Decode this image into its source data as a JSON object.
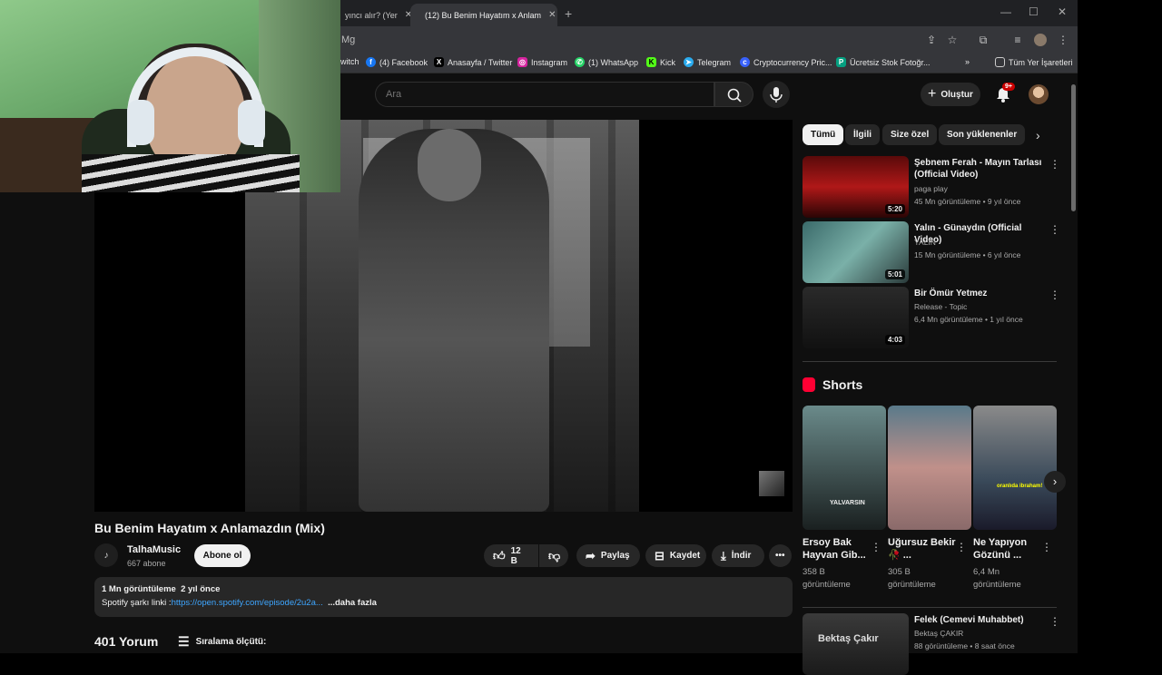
{
  "browser": {
    "tabs": [
      {
        "label": "yıncı alır? (Yer"
      },
      {
        "label": "(12) Bu Benim Hayatım x Anlam"
      }
    ],
    "address": "Mg",
    "bookmarks": [
      {
        "label": "witch",
        "icon": "twitch-icon"
      },
      {
        "label": "(4) Facebook",
        "icon": "facebook-icon",
        "color": "#1877f2"
      },
      {
        "label": "Anasayfa / Twitter",
        "icon": "x-icon",
        "color": "#000000"
      },
      {
        "label": "Instagram",
        "icon": "instagram-icon",
        "color": "#d6249f"
      },
      {
        "label": "(1) WhatsApp",
        "icon": "whatsapp-icon",
        "color": "#25d366"
      },
      {
        "label": "Kick",
        "icon": "kick-icon",
        "color": "#53fc18"
      },
      {
        "label": "Telegram",
        "icon": "telegram-icon",
        "color": "#2aabee"
      },
      {
        "label": "Cryptocurrency Pric...",
        "icon": "coinmarketcap-icon",
        "color": "#3861fb"
      },
      {
        "label": "Ücretsiz Stok Fotoğr...",
        "icon": "pexels-icon",
        "color": "#05a081"
      }
    ],
    "all_bookmarks": "Tüm Yer İşaretleri"
  },
  "youtube": {
    "search_placeholder": "Ara",
    "create_label": "Oluştur",
    "notifications_badge": "9+"
  },
  "video": {
    "title": "Bu Benim Hayatım x Anlamazdın (Mix)",
    "channel": "TalhaMusic",
    "subscribers": "667 abone",
    "subscribe_label": "Abone ol",
    "likes": "12 B",
    "share_label": "Paylaş",
    "save_label": "Kaydet",
    "download_label": "İndir",
    "views": "1 Mn görüntüleme",
    "age": "2 yıl önce",
    "desc_prefix": "Spotify şarkı linki :",
    "desc_link": "https://open.spotify.com/episode/2u2a...",
    "desc_more": "...daha fazla",
    "comments_count": "401 Yorum",
    "sort_label": "Sıralama ölçütü:"
  },
  "chips": [
    "Tümü",
    "İlgili",
    "Size özel",
    "Son yüklenenler"
  ],
  "recommendations": [
    {
      "title": "Şebnem Ferah - Mayın Tarlası (Official Video)",
      "channel": "paga play",
      "meta": "45 Mn görüntüleme • 9 yıl önce",
      "duration": "5:20"
    },
    {
      "title": "Yalın - Günaydın (Official Video)",
      "channel": "YALIN",
      "meta": "15 Mn görüntüleme • 6 yıl önce",
      "duration": "5:01"
    },
    {
      "title": "Bir Ömür Yetmez",
      "channel": "Release - Topic",
      "meta": "6,4 Mn görüntüleme • 1 yıl önce",
      "duration": "4:03"
    },
    {
      "title": "Felek (Cemevi Muhabbet)",
      "channel": "Bektaş ÇAKIR",
      "meta": "88 görüntüleme • 8 saat önce",
      "duration": ""
    }
  ],
  "shorts_title": "Shorts",
  "shorts": [
    {
      "title": "Ersoy Bak Hayvan Gib...",
      "views": "358 B görüntüleme",
      "overlay": "YALVARSIN"
    },
    {
      "title": "Uğursuz Bekir🥀 ...",
      "views": "305 B görüntüleme",
      "overlay": ""
    },
    {
      "title": "Ne Yapıyon Gözünü ...",
      "views": "6,4 Mn görüntüleme",
      "overlay": "oranlıda ibraham!"
    }
  ],
  "last_thumb_text": "Bektaş Çakır"
}
